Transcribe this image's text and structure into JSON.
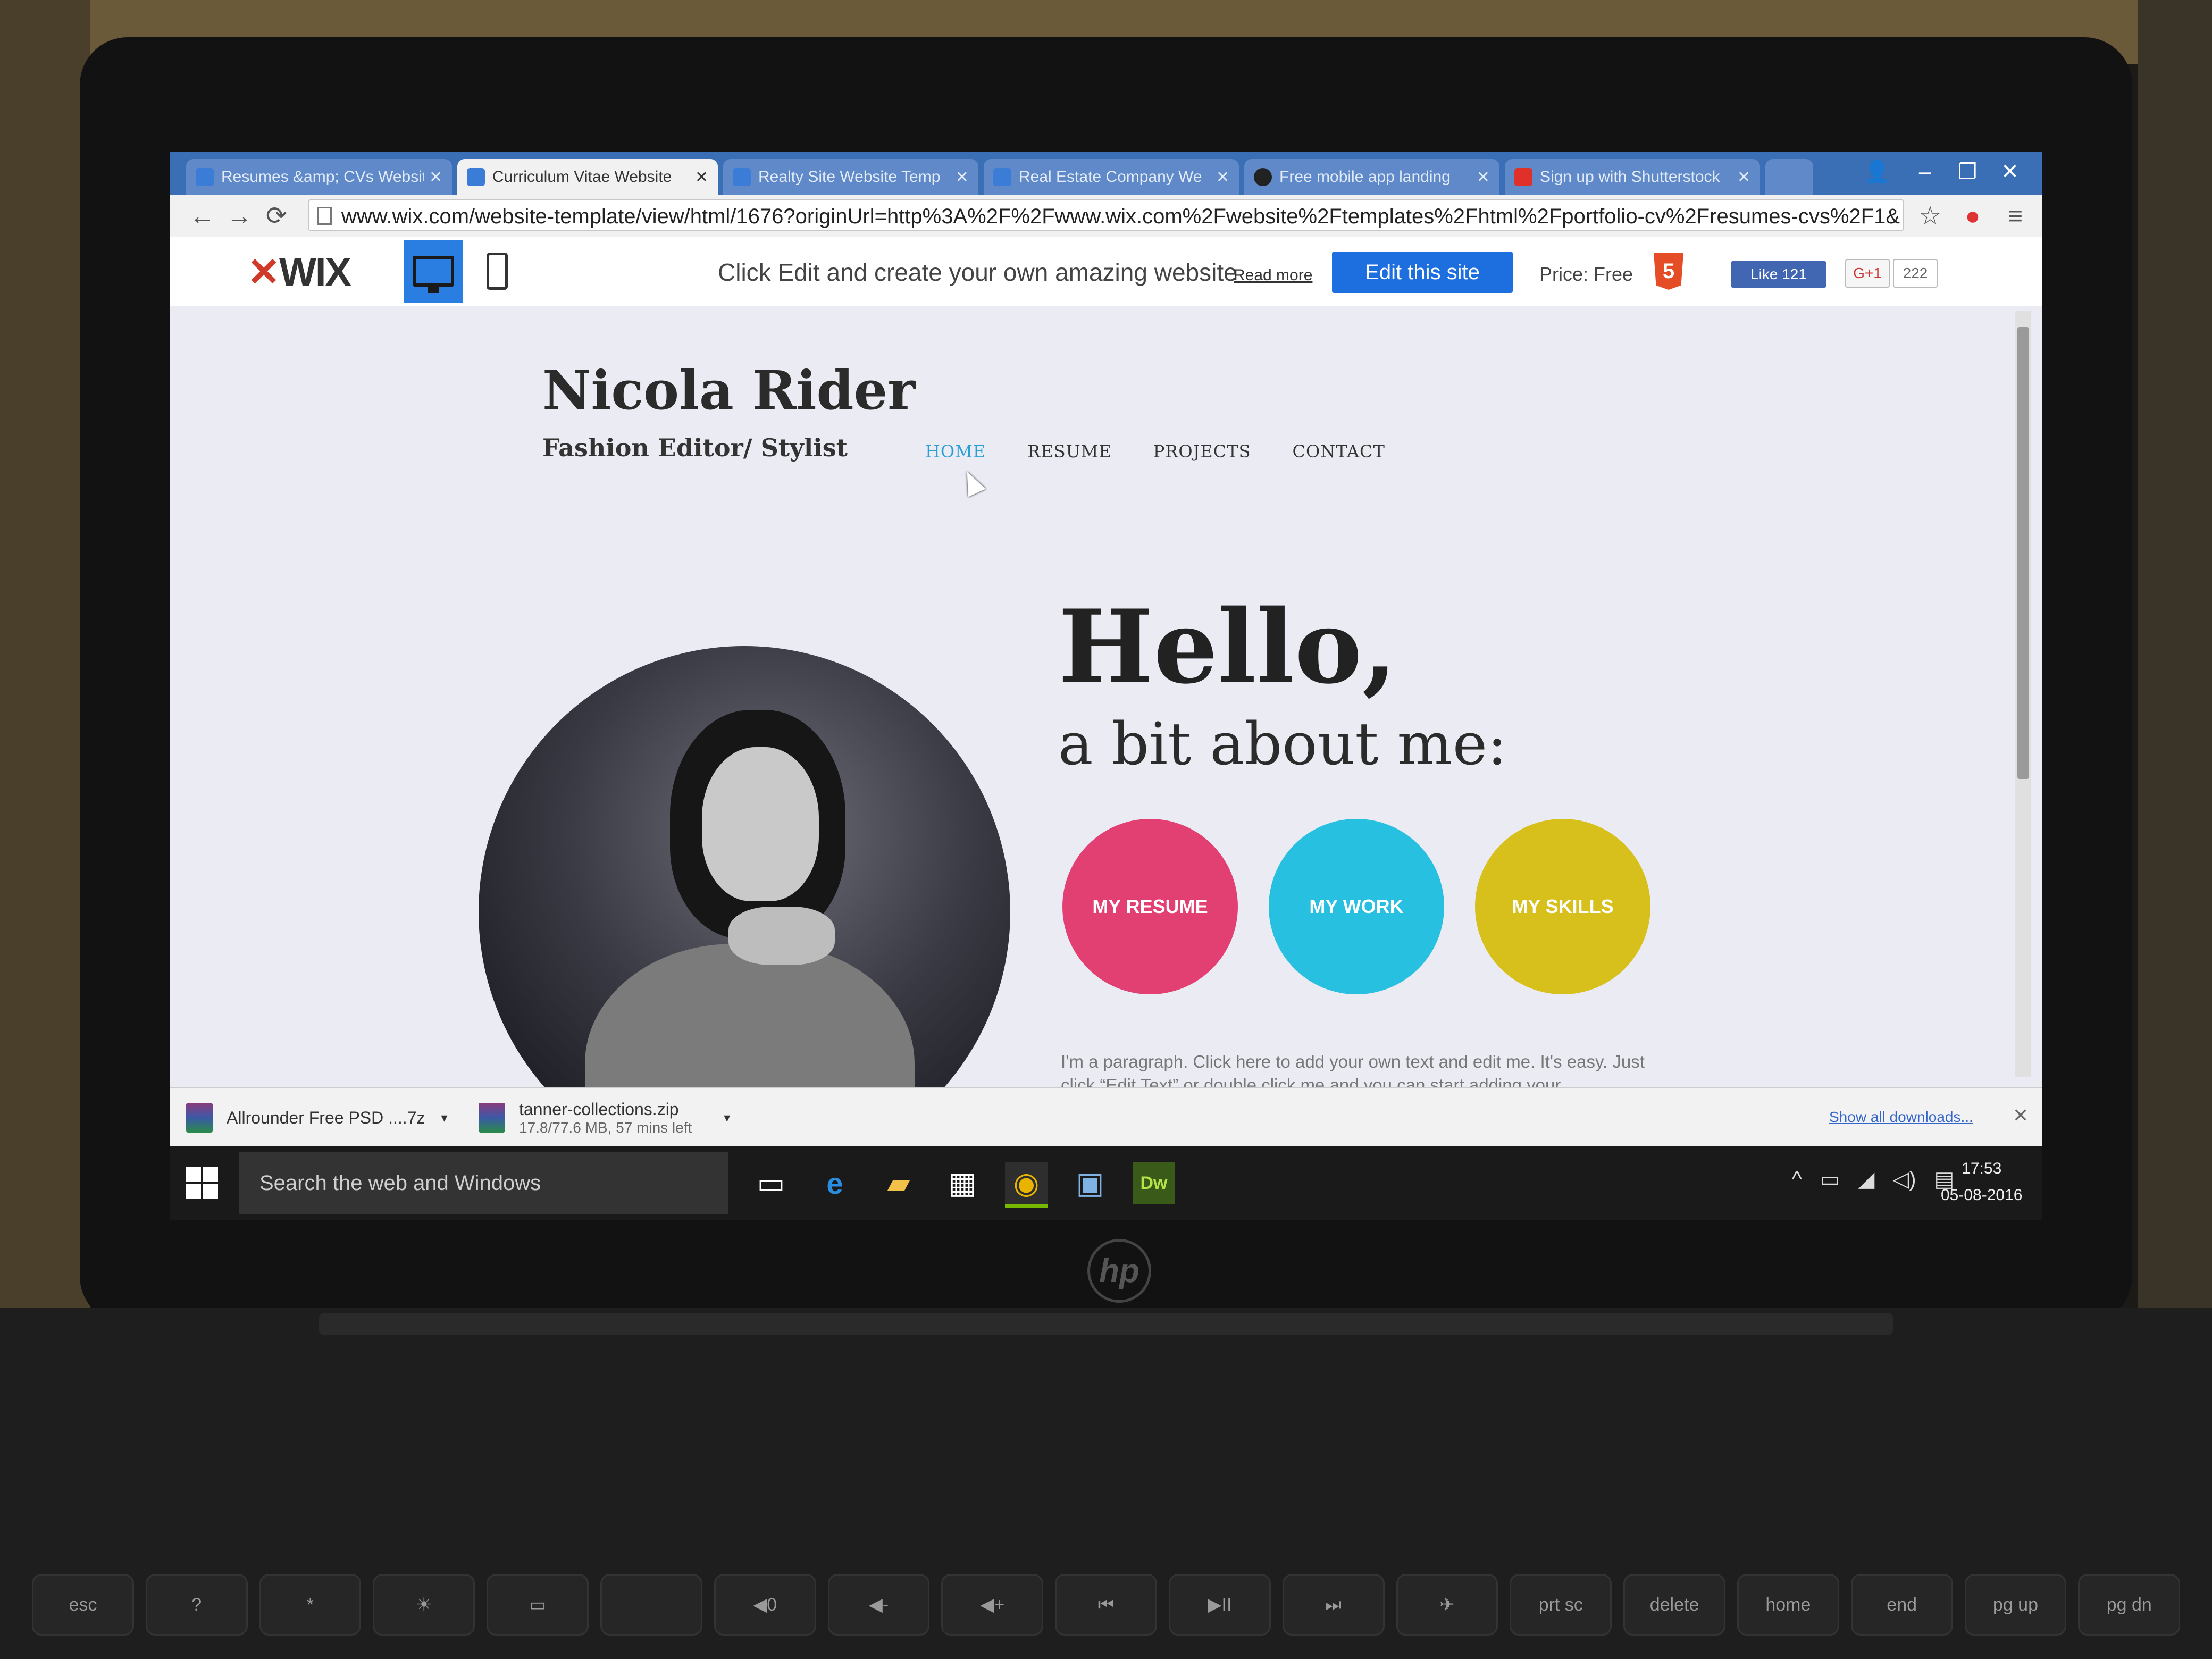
{
  "browser": {
    "tabs": [
      {
        "label": "Resumes &amp; CVs Website",
        "favicon_color": "#3b7cd6"
      },
      {
        "label": "Curriculum Vitae Website",
        "favicon_color": "#3b7cd6"
      },
      {
        "label": "Realty Site Website Temp",
        "favicon_color": "#3b7cd6"
      },
      {
        "label": "Real Estate Company We",
        "favicon_color": "#3b7cd6"
      },
      {
        "label": "Free mobile app landing",
        "favicon_color": "#222222"
      },
      {
        "label": "Sign up with Shutterstock",
        "favicon_color": "#e0302a"
      }
    ],
    "url": "www.wix.com/website-template/view/html/1676?originUrl=http%3A%2F%2Fwww.wix.com%2Fwebsite%2Ftemplates%2Fhtml%2Fportfolio-cv%2Fresumes-cvs%2F1&"
  },
  "wix_toolbar": {
    "logo": "WIX",
    "prompt": "Click Edit and create your own amazing website",
    "read_more": "Read more",
    "edit_button": "Edit this site",
    "price": "Price: Free",
    "html5_label": "5",
    "fb_like": "Like 121",
    "gplus": "G+1",
    "gplus_count": "222"
  },
  "site": {
    "name": "Nicola Rider",
    "subtitle": "Fashion Editor/ Stylist",
    "nav": [
      "HOME",
      "RESUME",
      "PROJECTS",
      "CONTACT"
    ],
    "hello": "Hello,",
    "about": "a bit about me:",
    "buttons": {
      "resume": "MY RESUME",
      "work": "MY WORK",
      "skills": "MY SKILLS"
    },
    "paragraph": "I'm a paragraph. Click here to add your own text and edit me. It's easy. Just click “Edit Text” or double click me and you can start adding your"
  },
  "downloads": {
    "items": [
      {
        "name": "Allrounder Free PSD ....7z"
      },
      {
        "name": "tanner-collections.zip",
        "status": "17.8/77.6 MB, 57 mins left"
      }
    ],
    "show_all": "Show all downloads..."
  },
  "taskbar": {
    "search_placeholder": "Search the web and Windows",
    "dw_label": "Dw",
    "time": "17:53",
    "date": "05-08-2016"
  },
  "keyboard": {
    "keys": [
      "esc",
      "?",
      "*",
      "☀",
      "▭",
      "",
      "◀0",
      "◀-",
      "◀+",
      "⏮",
      "▶II",
      "⏭",
      "✈",
      "prt sc",
      "delete",
      "home",
      "end",
      "pg up",
      "pg dn"
    ]
  }
}
